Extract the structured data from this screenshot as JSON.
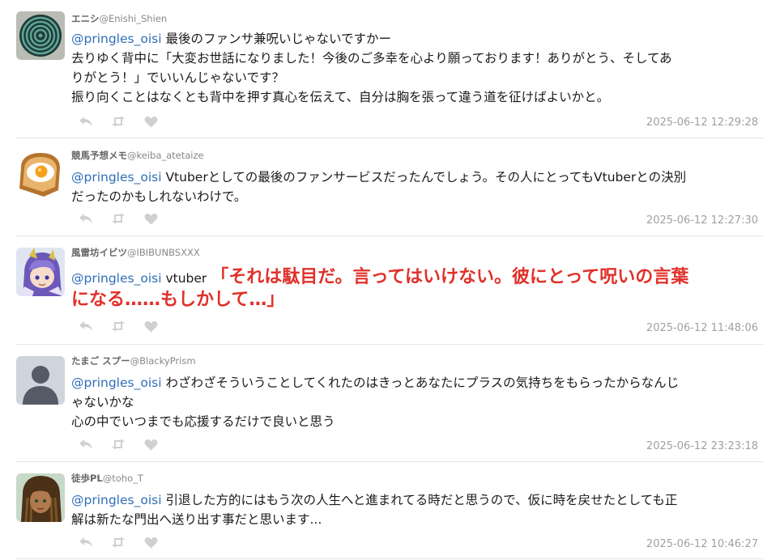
{
  "tweets": [
    {
      "name": "エニシ",
      "handle": "@Enishi_Shien",
      "mention": "@pringles_oisi",
      "lines": [
        " 最後のファンサ兼呪いじゃないですかー",
        "去りゆく背中に「大変お世話になりました！今後のご多幸を心より願っております！ありがとう、そしてあ",
        "りがとう！」でいいんじゃないです？",
        "振り向くことはなくとも背中を押す真心を伝えて、自分は胸を張って違う道を征けばよいかと。"
      ],
      "time": "2025-06-12 12:29:28",
      "avatar": "spiral-avatar"
    },
    {
      "name": "競馬予想メモ",
      "handle": "@keiba_atetaize",
      "mention": "@pringles_oisi",
      "lines": [
        " Vtuberとしての最後のファンサービスだったんでしょう。その人にとってもVtuberとの決別",
        "だったのかもしれないわけで。"
      ],
      "time": "2025-06-12 12:27:30",
      "avatar": "toast-egg-avatar"
    },
    {
      "name": "風雷坊イビツ",
      "handle": "@IBIBUNBSXXX",
      "mention": "@pringles_oisi",
      "text_prefix": " vtuber ",
      "emphasis_line1": "「それは駄目だ。言ってはいけない。彼にとって呪いの言葉",
      "emphasis_line2": "になる……もしかして…」",
      "time": "2025-06-12 11:48:06",
      "avatar": "anime-character-avatar"
    },
    {
      "name": "たまご スプー",
      "handle": "@BlackyPrism",
      "mention": "@pringles_oisi",
      "lines": [
        " わざわざそういうことしてくれたのはきっとあなたにプラスの気持ちをもらったからなんじ",
        "ゃないかな",
        "心の中でいつまでも応援するだけで良いと思う"
      ],
      "time": "2025-06-12 23:23:18",
      "avatar": "default-user-avatar"
    },
    {
      "name": "徒歩PL",
      "handle": "@toho_T",
      "mention": "@pringles_oisi",
      "lines": [
        " 引退した方的にはもう次の人生へと進まれてる時だと思うので、仮に時を戻せたとしても正",
        "解は新たな門出へ送り出す事だと思います..."
      ],
      "time": "2025-06-12 10:46:27",
      "avatar": "dreadlocks-avatar"
    }
  ],
  "icons": [
    "reply-icon",
    "retweet-icon",
    "like-icon"
  ],
  "colors": {
    "mention": "#2f6fb8",
    "emphasis": "#e0312a",
    "timestamp": "#a0a0a0",
    "icon": "#d0d0d0"
  }
}
